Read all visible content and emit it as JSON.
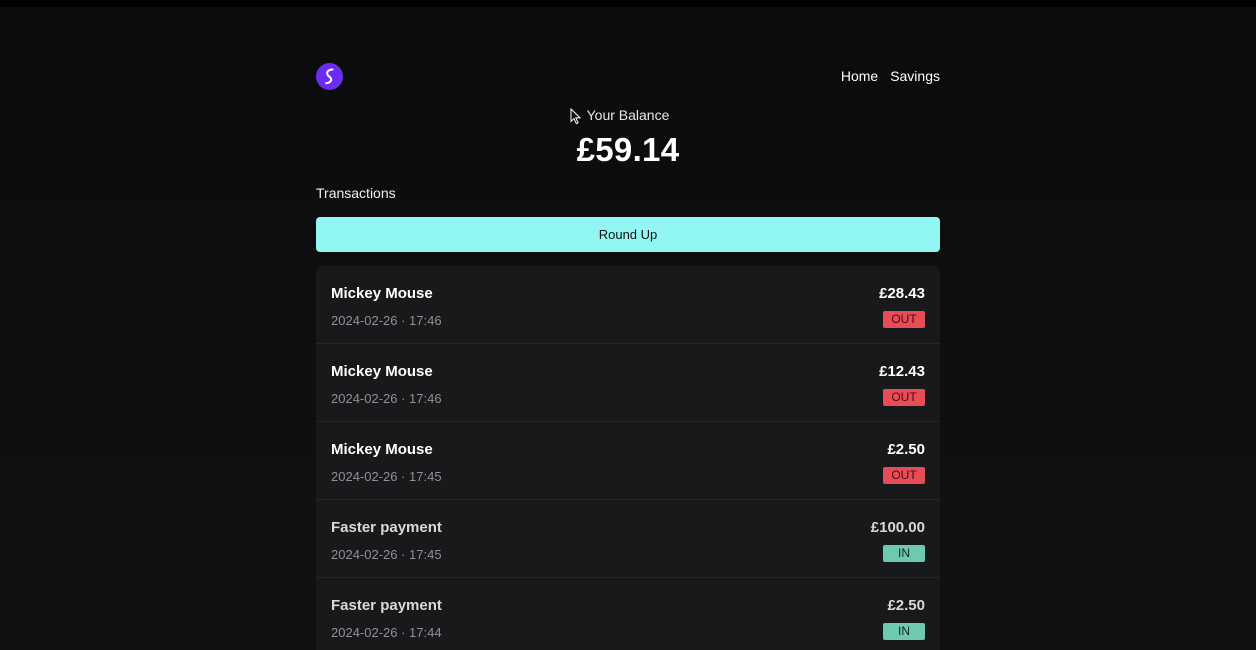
{
  "header": {
    "nav": [
      {
        "label": "Home"
      },
      {
        "label": "Savings"
      }
    ]
  },
  "balance": {
    "label": "Your Balance",
    "value": "£59.14"
  },
  "transactions": {
    "title": "Transactions",
    "round_up_label": "Round Up",
    "items": [
      {
        "name": "Mickey Mouse",
        "date": "2024-02-26 · 17:46",
        "amount": "£28.43",
        "direction": "OUT"
      },
      {
        "name": "Mickey Mouse",
        "date": "2024-02-26 · 17:46",
        "amount": "£12.43",
        "direction": "OUT"
      },
      {
        "name": "Mickey Mouse",
        "date": "2024-02-26 · 17:45",
        "amount": "£2.50",
        "direction": "OUT"
      },
      {
        "name": "Faster payment",
        "date": "2024-02-26 · 17:45",
        "amount": "£100.00",
        "direction": "IN"
      },
      {
        "name": "Faster payment",
        "date": "2024-02-26 · 17:44",
        "amount": "£2.50",
        "direction": "IN"
      }
    ]
  },
  "colors": {
    "background": "#0e0f10",
    "accent_button": "#92f6f2",
    "logo": "#6c2bf0",
    "badge_out": "#e84c57",
    "badge_in": "#6ecaae"
  },
  "icons": {
    "logo": "s-logo-icon",
    "cursor": "mouse-pointer-icon"
  }
}
